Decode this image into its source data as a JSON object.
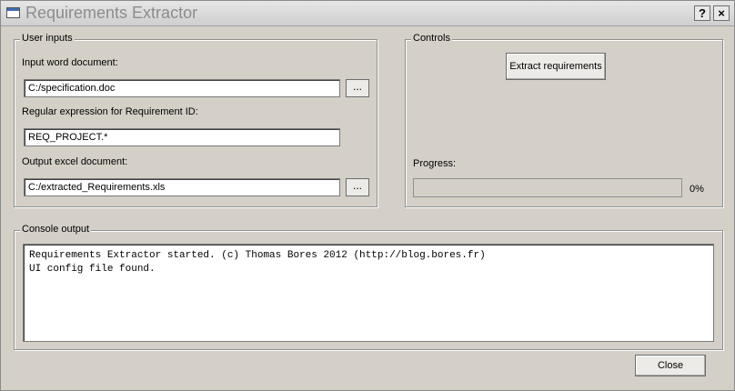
{
  "window": {
    "title": "Requirements Extractor",
    "help_label": "?",
    "close_label": "×"
  },
  "user_inputs": {
    "group_label": "User inputs",
    "input_doc": {
      "label": "Input word document:",
      "value": "C:/specification.doc",
      "browse": "..."
    },
    "regex": {
      "label": "Regular expression for Requirement ID:",
      "value": "REQ_PROJECT.*"
    },
    "output_doc": {
      "label": "Output excel document:",
      "value": "C:/extracted_Requirements.xls",
      "browse": "..."
    }
  },
  "controls": {
    "group_label": "Controls",
    "extract_button": "Extract requirements",
    "progress_label": "Progress:",
    "progress_value": 0,
    "progress_text": "0%"
  },
  "console": {
    "group_label": "Console output",
    "lines": [
      "Requirements Extractor started. (c) Thomas Bores 2012 (http://blog.bores.fr)",
      "UI config file found."
    ]
  },
  "footer": {
    "close_button": "Close"
  },
  "colors": {
    "window_bg": "#d4d0c8",
    "progress_fill": "#3b6fb6"
  }
}
